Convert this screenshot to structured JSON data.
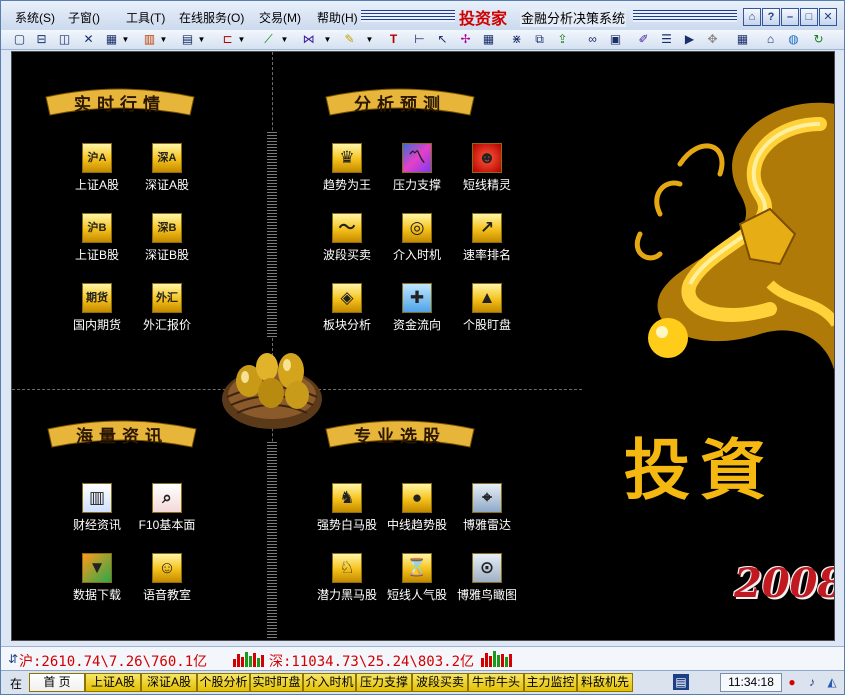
{
  "menu": {
    "items": [
      "系统(S)",
      "子窗()",
      "工具(T)",
      "在线服务(O)",
      "交易(M)",
      "帮助(H)"
    ],
    "app_name": "投资家",
    "app_subtitle": "金融分析决策系统"
  },
  "window_buttons": [
    "home-icon",
    "help-icon",
    "minimize-icon",
    "restore-icon",
    "close-icon"
  ],
  "sections": {
    "realtime": {
      "title": "实时行情",
      "items": [
        {
          "icon_text": "沪A",
          "label": "上证A股"
        },
        {
          "icon_text": "深A",
          "label": "深证A股"
        },
        {
          "icon_text": "沪B",
          "label": "上证B股"
        },
        {
          "icon_text": "深B",
          "label": "深证B股"
        },
        {
          "icon_text": "期货",
          "label": "国内期货"
        },
        {
          "icon_text": "外汇",
          "label": "外汇报价"
        }
      ]
    },
    "analysis": {
      "title": "分析预测",
      "items": [
        {
          "icon": "trend-icon",
          "label": "趋势为王"
        },
        {
          "icon": "pressure-support-icon",
          "label": "压力支撑"
        },
        {
          "icon": "short-spirit-icon",
          "label": "短线精灵"
        },
        {
          "icon": "wave-trade-icon",
          "label": "波段买卖"
        },
        {
          "icon": "timing-icon",
          "label": "介入时机"
        },
        {
          "icon": "speed-rank-icon",
          "label": "速率排名"
        },
        {
          "icon": "sector-icon",
          "label": "板块分析"
        },
        {
          "icon": "fund-flow-icon",
          "label": "资金流向"
        },
        {
          "icon": "stock-watch-icon",
          "label": "个股盯盘"
        }
      ]
    },
    "news": {
      "title": "海量资讯",
      "items": [
        {
          "icon": "finance-news-icon",
          "label": "财经资讯"
        },
        {
          "icon": "f10-icon",
          "label": "F10基本面"
        },
        {
          "icon": "download-icon",
          "label": "数据下载"
        },
        {
          "icon": "voice-class-icon",
          "label": "语音教室"
        }
      ]
    },
    "picker": {
      "title": "专业选股",
      "items": [
        {
          "icon": "white-horse-icon",
          "label": "强势白马股"
        },
        {
          "icon": "mid-trend-icon",
          "label": "中线趋势股"
        },
        {
          "icon": "radar-icon",
          "label": "博雅雷达"
        },
        {
          "icon": "dark-horse-icon",
          "label": "潜力黑马股"
        },
        {
          "icon": "popular-icon",
          "label": "短线人气股"
        },
        {
          "icon": "birdseye-icon",
          "label": "博雅鸟瞰图"
        }
      ]
    }
  },
  "brand": {
    "big_title": "投資",
    "year": "2008"
  },
  "ticker": {
    "sh": "沪:2610.74\\7.26\\760.1亿",
    "sz": "深:11034.73\\25.24\\803.2亿"
  },
  "tabs": {
    "left_marker": "在",
    "items": [
      "首 页",
      "上证A股",
      "深证A股",
      "个股分析",
      "实时盯盘",
      "介入时机",
      "压力支撑",
      "波段买卖",
      "牛市牛头",
      "主力监控",
      "料敌机先"
    ],
    "active_index": 0
  },
  "status": {
    "time": "11:34:18"
  },
  "colors": {
    "menu_bg": "#d9e4f3",
    "main_bg": "#000000",
    "gold": "#f5b811",
    "red": "#d20000",
    "label_white": "#ffffff"
  }
}
